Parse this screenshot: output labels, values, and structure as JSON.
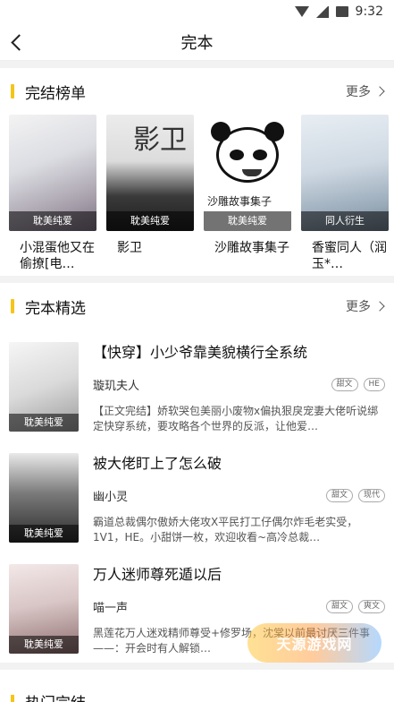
{
  "status_bar": {
    "time": "9:32"
  },
  "header": {
    "title": "完本"
  },
  "ranking": {
    "title": "完结榜单",
    "more_label": "更多",
    "books": [
      {
        "name": "小混蛋他又在偷撩[电…",
        "tag": "耽美纯爱"
      },
      {
        "name": "影卫",
        "tag": "耽美纯爱",
        "cover_text": "影卫"
      },
      {
        "name": "沙雕故事集子",
        "tag": "耽美纯爱",
        "cover_text": "沙雕故事集子"
      },
      {
        "name": "香蜜同人（润玉*…",
        "tag": "同人衍生"
      }
    ]
  },
  "picks": {
    "title": "完本精选",
    "more_label": "更多",
    "books": [
      {
        "title": "【快穿】小少爷靠美貌横行全系统",
        "author": "璇玑夫人",
        "tags": [
          "甜文",
          "HE"
        ],
        "desc": "【正文完结】娇软哭包美丽小废物x偏执狠戾宠妻大佬听说绑定快穿系统，要攻略各个世界的反派，让他爱…",
        "cover_tag": "耽美纯爱"
      },
      {
        "title": "被大佬盯上了怎么破",
        "author": "幽小灵",
        "tags": [
          "甜文",
          "现代"
        ],
        "desc": "霸道总裁偶尔傲娇大佬攻X平民打工仔偶尔炸毛老实受，1V1，HE。小甜饼一枚，欢迎收看~高冷总裁…",
        "cover_tag": "耽美纯爱"
      },
      {
        "title": "万人迷师尊死遁以后",
        "author": "喵一声",
        "tags": [
          "甜文",
          "爽文"
        ],
        "desc": "黑莲花万人迷戏精师尊受+修罗场，沈棠以前最讨厌三件事——：开会时有人解锁…",
        "cover_tag": "耽美纯爱"
      }
    ]
  },
  "next_section": {
    "title": "热门完结"
  },
  "watermark": {
    "text": "天源游戏网"
  },
  "colors": {
    "accent": "#f5c518"
  }
}
